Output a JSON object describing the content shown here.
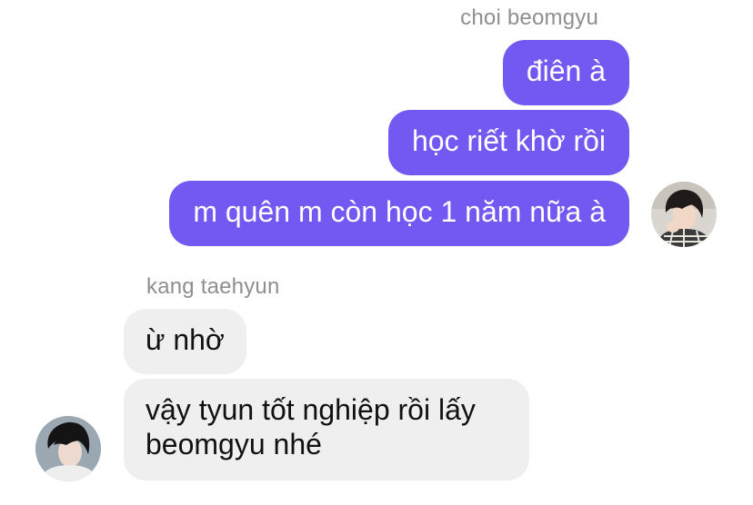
{
  "conversation": {
    "outgoing": {
      "sender": "choi beomgyu",
      "messages": [
        "điên à",
        "học riết khờ rồi",
        "m quên m còn học 1 năm nữa à"
      ]
    },
    "incoming": {
      "sender": "kang taehyun",
      "messages": [
        "ừ nhờ",
        "vậy tyun tốt nghiệp rồi lấy\nbeomgyu nhé"
      ]
    }
  },
  "colors": {
    "outgoing_bubble": "#7458f2",
    "incoming_bubble": "#efeff0",
    "sender_name": "#8e8e93"
  }
}
